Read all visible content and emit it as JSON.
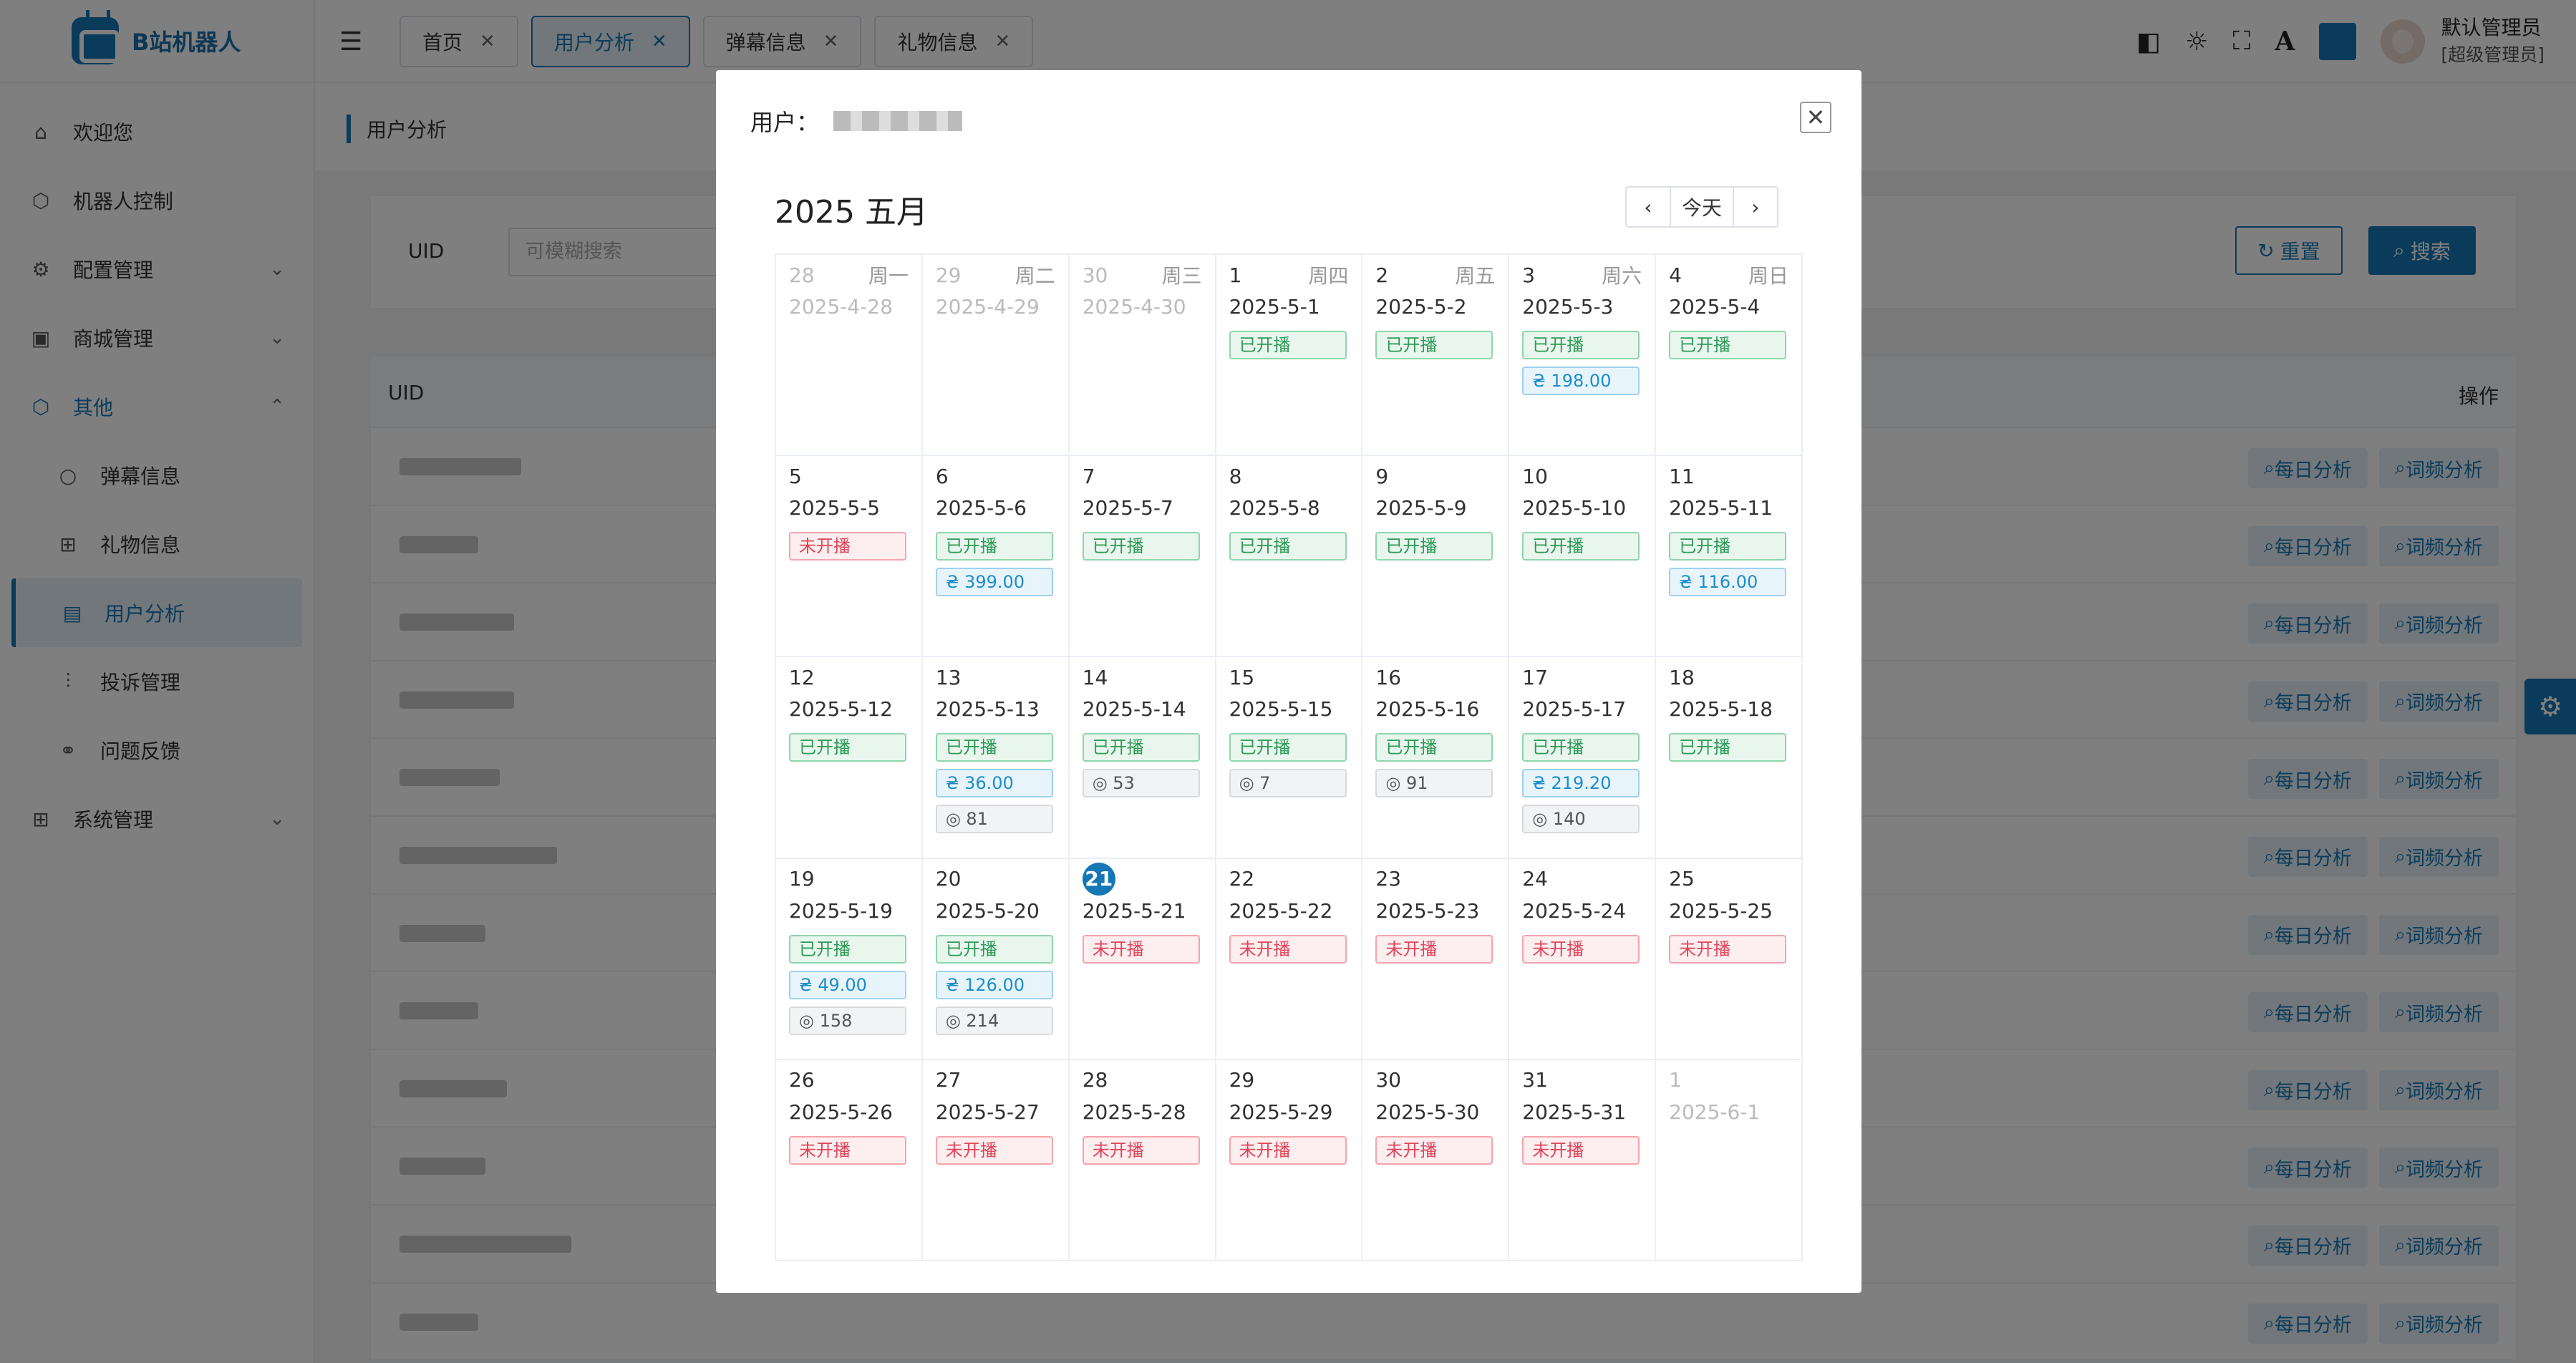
{
  "app": {
    "name": "B站机器人"
  },
  "sidebar": {
    "items": [
      {
        "label": "欢迎您",
        "icon": "home-icon",
        "glyph": "⌂"
      },
      {
        "label": "机器人控制",
        "icon": "cube-icon",
        "glyph": "⬡"
      },
      {
        "label": "配置管理",
        "icon": "gear-icon",
        "glyph": "⚙",
        "chev": "⌄"
      },
      {
        "label": "商城管理",
        "icon": "bag-icon",
        "glyph": "▣",
        "chev": "⌄"
      },
      {
        "label": "其他",
        "icon": "box-icon",
        "glyph": "⬡",
        "chev": "⌃"
      },
      {
        "label": "弹幕信息",
        "icon": "comment-icon",
        "glyph": "○"
      },
      {
        "label": "礼物信息",
        "icon": "gift-icon",
        "glyph": "⊞"
      },
      {
        "label": "用户分析",
        "icon": "chart-icon",
        "glyph": "▤"
      },
      {
        "label": "投诉管理",
        "icon": "sliders-icon",
        "glyph": "⫶"
      },
      {
        "label": "问题反馈",
        "icon": "link-icon",
        "glyph": "⚭"
      },
      {
        "label": "系统管理",
        "icon": "grid-icon",
        "glyph": "⊞",
        "chev": "⌄"
      }
    ]
  },
  "header": {
    "tabs": [
      {
        "label": "首页"
      },
      {
        "label": "用户分析"
      },
      {
        "label": "弹幕信息"
      },
      {
        "label": "礼物信息"
      }
    ],
    "user": {
      "name": "默认管理员",
      "role": "[超级管理员]"
    },
    "accent": "#1677b5"
  },
  "breadcrumb": {
    "label": "用户分析"
  },
  "search": {
    "label": "UID",
    "placeholder": "可模糊搜索",
    "reset": "重置",
    "submit": "搜索"
  },
  "table": {
    "col_uid": "UID",
    "col_op": "操作",
    "btn_daily": "每日分析",
    "btn_freq": "词频分析",
    "rows": 12
  },
  "modal": {
    "title": "用户：",
    "heading": "2025 五月",
    "today": "今天",
    "weeks": [
      [
        {
          "num": "28",
          "wd": "周一",
          "date": "2025-4-28",
          "other": true,
          "tags": []
        },
        {
          "num": "29",
          "wd": "周二",
          "date": "2025-4-29",
          "other": true,
          "tags": []
        },
        {
          "num": "30",
          "wd": "周三",
          "date": "2025-4-30",
          "other": true,
          "tags": []
        },
        {
          "num": "1",
          "wd": "周四",
          "date": "2025-5-1",
          "tags": [
            {
              "t": "on",
              "v": "已开播"
            }
          ]
        },
        {
          "num": "2",
          "wd": "周五",
          "date": "2025-5-2",
          "tags": [
            {
              "t": "on",
              "v": "已开播"
            }
          ]
        },
        {
          "num": "3",
          "wd": "周六",
          "date": "2025-5-3",
          "tags": [
            {
              "t": "on",
              "v": "已开播"
            },
            {
              "t": "money",
              "v": "₴ 198.00"
            }
          ]
        },
        {
          "num": "4",
          "wd": "周日",
          "date": "2025-5-4",
          "tags": [
            {
              "t": "on",
              "v": "已开播"
            }
          ]
        }
      ],
      [
        {
          "num": "5",
          "date": "2025-5-5",
          "tags": [
            {
              "t": "off",
              "v": "未开播"
            }
          ]
        },
        {
          "num": "6",
          "date": "2025-5-6",
          "tags": [
            {
              "t": "on",
              "v": "已开播"
            },
            {
              "t": "money",
              "v": "₴ 399.00"
            }
          ]
        },
        {
          "num": "7",
          "date": "2025-5-7",
          "tags": [
            {
              "t": "on",
              "v": "已开播"
            }
          ]
        },
        {
          "num": "8",
          "date": "2025-5-8",
          "tags": [
            {
              "t": "on",
              "v": "已开播"
            }
          ]
        },
        {
          "num": "9",
          "date": "2025-5-9",
          "tags": [
            {
              "t": "on",
              "v": "已开播"
            }
          ]
        },
        {
          "num": "10",
          "date": "2025-5-10",
          "tags": [
            {
              "t": "on",
              "v": "已开播"
            }
          ]
        },
        {
          "num": "11",
          "date": "2025-5-11",
          "tags": [
            {
              "t": "on",
              "v": "已开播"
            },
            {
              "t": "money",
              "v": "₴ 116.00"
            }
          ]
        }
      ],
      [
        {
          "num": "12",
          "date": "2025-5-12",
          "tags": [
            {
              "t": "on",
              "v": "已开播"
            }
          ]
        },
        {
          "num": "13",
          "date": "2025-5-13",
          "tags": [
            {
              "t": "on",
              "v": "已开播"
            },
            {
              "t": "money",
              "v": "₴ 36.00"
            },
            {
              "t": "count",
              "v": "◎ 81"
            }
          ]
        },
        {
          "num": "14",
          "date": "2025-5-14",
          "tags": [
            {
              "t": "on",
              "v": "已开播"
            },
            {
              "t": "count",
              "v": "◎ 53"
            }
          ]
        },
        {
          "num": "15",
          "date": "2025-5-15",
          "tags": [
            {
              "t": "on",
              "v": "已开播"
            },
            {
              "t": "count",
              "v": "◎ 7"
            }
          ]
        },
        {
          "num": "16",
          "date": "2025-5-16",
          "tags": [
            {
              "t": "on",
              "v": "已开播"
            },
            {
              "t": "count",
              "v": "◎ 91"
            }
          ]
        },
        {
          "num": "17",
          "date": "2025-5-17",
          "tags": [
            {
              "t": "on",
              "v": "已开播"
            },
            {
              "t": "money",
              "v": "₴ 219.20"
            },
            {
              "t": "count",
              "v": "◎ 140"
            }
          ]
        },
        {
          "num": "18",
          "date": "2025-5-18",
          "tags": [
            {
              "t": "on",
              "v": "已开播"
            }
          ]
        }
      ],
      [
        {
          "num": "19",
          "date": "2025-5-19",
          "tags": [
            {
              "t": "on",
              "v": "已开播"
            },
            {
              "t": "money",
              "v": "₴ 49.00"
            },
            {
              "t": "count",
              "v": "◎ 158"
            }
          ]
        },
        {
          "num": "20",
          "date": "2025-5-20",
          "tags": [
            {
              "t": "on",
              "v": "已开播"
            },
            {
              "t": "money",
              "v": "₴ 126.00"
            },
            {
              "t": "count",
              "v": "◎ 214"
            }
          ]
        },
        {
          "num": "21",
          "date": "2025-5-21",
          "today": true,
          "tags": [
            {
              "t": "off",
              "v": "未开播"
            }
          ]
        },
        {
          "num": "22",
          "date": "2025-5-22",
          "tags": [
            {
              "t": "off",
              "v": "未开播"
            }
          ]
        },
        {
          "num": "23",
          "date": "2025-5-23",
          "tags": [
            {
              "t": "off",
              "v": "未开播"
            }
          ]
        },
        {
          "num": "24",
          "date": "2025-5-24",
          "tags": [
            {
              "t": "off",
              "v": "未开播"
            }
          ]
        },
        {
          "num": "25",
          "date": "2025-5-25",
          "tags": [
            {
              "t": "off",
              "v": "未开播"
            }
          ]
        }
      ],
      [
        {
          "num": "26",
          "date": "2025-5-26",
          "tags": [
            {
              "t": "off",
              "v": "未开播"
            }
          ]
        },
        {
          "num": "27",
          "date": "2025-5-27",
          "tags": [
            {
              "t": "off",
              "v": "未开播"
            }
          ]
        },
        {
          "num": "28",
          "date": "2025-5-28",
          "tags": [
            {
              "t": "off",
              "v": "未开播"
            }
          ]
        },
        {
          "num": "29",
          "date": "2025-5-29",
          "tags": [
            {
              "t": "off",
              "v": "未开播"
            }
          ]
        },
        {
          "num": "30",
          "date": "2025-5-30",
          "tags": [
            {
              "t": "off",
              "v": "未开播"
            }
          ]
        },
        {
          "num": "31",
          "date": "2025-5-31",
          "tags": [
            {
              "t": "off",
              "v": "未开播"
            }
          ]
        },
        {
          "num": "1",
          "date": "2025-6-1",
          "other": true,
          "tags": []
        }
      ]
    ]
  }
}
